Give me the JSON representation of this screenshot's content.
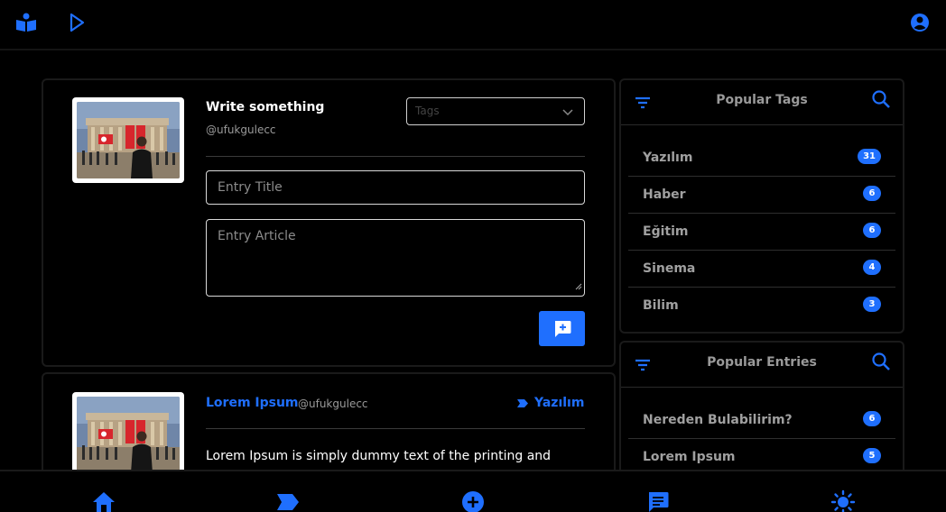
{
  "composer": {
    "title": "Write something",
    "handle": "@ufukgulecc",
    "tags_placeholder": "Tags",
    "entry_title_placeholder": "Entry Title",
    "entry_article_placeholder": "Entry Article"
  },
  "entry": {
    "title": "Lorem Ipsum",
    "handle": "@ufukgulecc",
    "tag": "Yazılım",
    "body": "Lorem Ipsum is simply dummy text of the printing and"
  },
  "popular_tags": {
    "title": "Popular Tags",
    "items": [
      {
        "label": "Yazılım",
        "count": "31"
      },
      {
        "label": "Haber",
        "count": "6"
      },
      {
        "label": "Eğitim",
        "count": "6"
      },
      {
        "label": "Sinema",
        "count": "4"
      },
      {
        "label": "Bilim",
        "count": "3"
      }
    ]
  },
  "popular_entries": {
    "title": "Popular Entries",
    "items": [
      {
        "label": "Nereden Bulabilirim?",
        "count": "6"
      },
      {
        "label": "Lorem Ipsum",
        "count": "5"
      }
    ]
  },
  "colors": {
    "accent": "#1f6ffe",
    "background": "#000000"
  },
  "icons": {
    "top_left": [
      "reader-icon",
      "play-icon"
    ],
    "top_right": "account-icon",
    "bottom": [
      "home-icon",
      "tag-icon",
      "add-circle-icon",
      "chat-icon",
      "sun-icon"
    ]
  }
}
